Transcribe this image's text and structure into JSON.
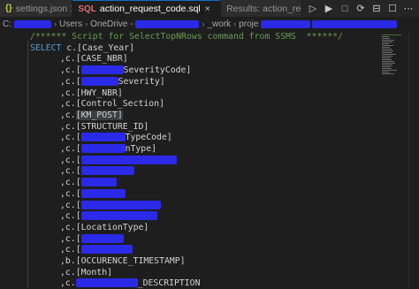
{
  "tabs": [
    {
      "icon": "{}",
      "label": "settings.json 1",
      "active": false,
      "closable": false
    },
    {
      "icon": "SQL",
      "label": "action_request_code.sql",
      "active": true,
      "closable": true
    },
    {
      "icon": "",
      "label": "Results: action_requ",
      "active": false,
      "closable": false
    }
  ],
  "tab_actions": [
    "▷",
    "▶",
    "□",
    "⟳",
    "⊟",
    "☐",
    "⋯"
  ],
  "breadcrumb": {
    "items": [
      "C:",
      "Users",
      "OneDrive -",
      "_work",
      "proje"
    ]
  },
  "editor": {
    "lines": [
      {
        "type": "comment",
        "text": "/****** Script for SelectTopNRows command from SSMS  ******/"
      },
      {
        "type": "select",
        "keyword": "SELECT",
        "prefix": "c.",
        "column": "[Case_Year]"
      },
      {
        "type": "col",
        "prefix": ",c.",
        "column": "[CASE_NBR]"
      },
      {
        "type": "col",
        "prefix": ",c.",
        "column": "[",
        "tail": "SeverityCode]",
        "redact": 48
      },
      {
        "type": "col",
        "prefix": ",c.",
        "column": "[",
        "tail": "Severity]",
        "redact": 42
      },
      {
        "type": "col",
        "prefix": ",c.",
        "column": "[HWY_NBR]"
      },
      {
        "type": "col",
        "prefix": ",c.",
        "column": "[Control_Section]"
      },
      {
        "type": "col",
        "prefix": ",c.",
        "column": "[KM_POST]",
        "selected": true
      },
      {
        "type": "col",
        "prefix": ",c.",
        "column": "[STRUCTURE_ID]"
      },
      {
        "type": "col",
        "prefix": ",c.",
        "column": "[",
        "tail": "TypeCode]",
        "redact": 50
      },
      {
        "type": "col",
        "prefix": ",c.",
        "column": "[",
        "tail": "nType]",
        "redact": 50
      },
      {
        "type": "col",
        "prefix": ",c.",
        "column": "[",
        "tail": "",
        "redact": 108
      },
      {
        "type": "col",
        "prefix": ",c.",
        "column": "[",
        "tail": "",
        "redact": 60
      },
      {
        "type": "col",
        "prefix": ",c.",
        "column": "[",
        "tail": "",
        "redact": 40
      },
      {
        "type": "col",
        "prefix": ",c.",
        "column": "[",
        "tail": "",
        "redact": 50
      },
      {
        "type": "col",
        "prefix": ",c.",
        "column": "[",
        "tail": "",
        "redact": 90
      },
      {
        "type": "col",
        "prefix": ",c.",
        "column": "[",
        "tail": "",
        "redact": 86
      },
      {
        "type": "col",
        "prefix": ",c.",
        "column": "[LocationType]"
      },
      {
        "type": "col",
        "prefix": ",c.",
        "column": "[",
        "tail": "",
        "redact": 48
      },
      {
        "type": "col",
        "prefix": ",c.",
        "column": "[",
        "tail": "",
        "redact": 58
      },
      {
        "type": "col",
        "prefix": ",b.",
        "column": "[OCCURENCE_TIMESTAMP]"
      },
      {
        "type": "col",
        "prefix": ",c.",
        "column": "[Month]"
      },
      {
        "type": "col",
        "prefix": ",c.",
        "column": "",
        "tail": "_DESCRIPTION",
        "redact": 70
      }
    ]
  },
  "colors": {
    "background": "#1e1e1e",
    "comment": "#6a9955",
    "keyword": "#569cd6",
    "text": "#d4d4d4",
    "redaction": "#2a2ae8",
    "tab_accent": "#0e70c0"
  }
}
